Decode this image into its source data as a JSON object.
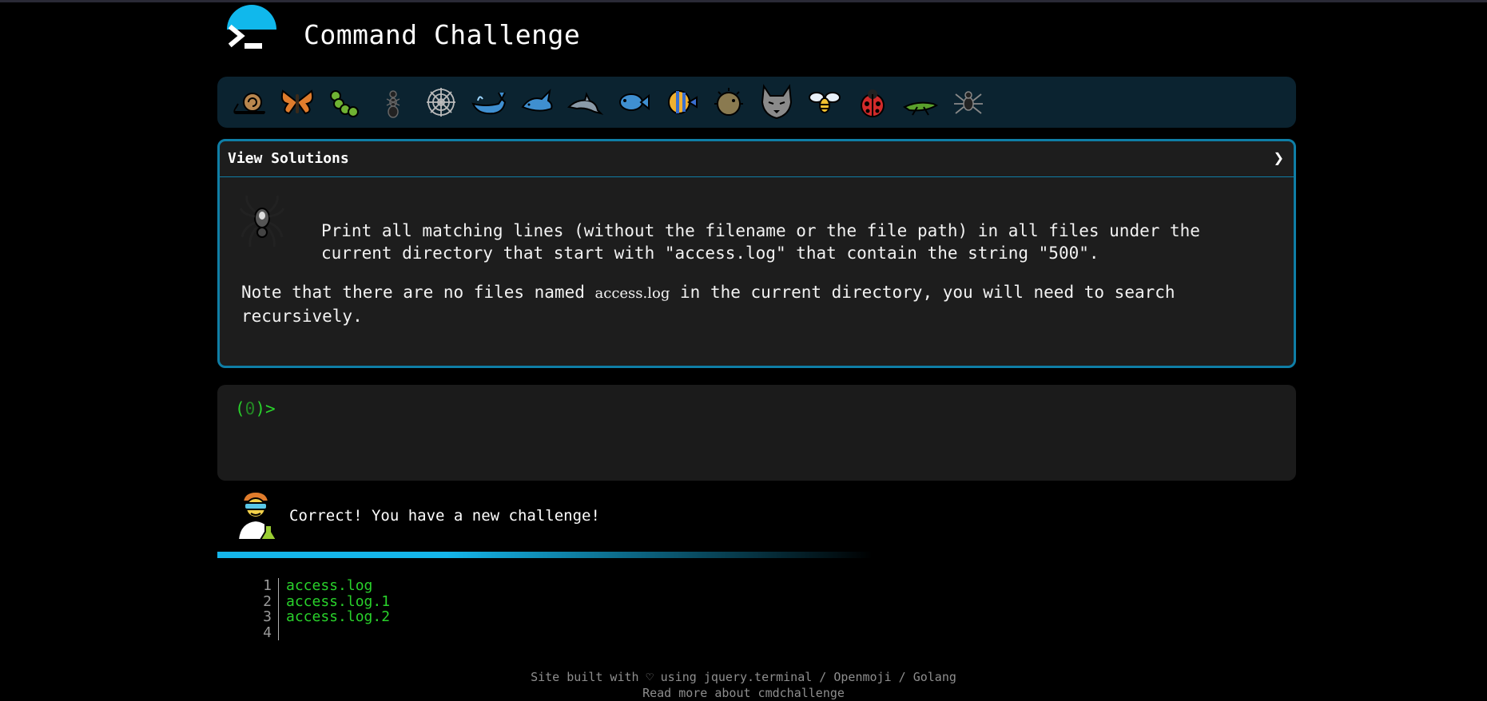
{
  "header": {
    "title": "Command Challenge"
  },
  "emoji_bar": {
    "items": [
      {
        "name": "snail-icon"
      },
      {
        "name": "butterfly-icon"
      },
      {
        "name": "caterpillar-icon"
      },
      {
        "name": "ant-icon"
      },
      {
        "name": "spider-web-icon"
      },
      {
        "name": "whale-icon"
      },
      {
        "name": "shark-icon"
      },
      {
        "name": "dolphin-icon"
      },
      {
        "name": "fish-icon"
      },
      {
        "name": "tropical-fish-icon"
      },
      {
        "name": "blowfish-icon"
      },
      {
        "name": "wolf-icon"
      },
      {
        "name": "bee-icon"
      },
      {
        "name": "ladybug-icon"
      },
      {
        "name": "cricket-icon"
      },
      {
        "name": "spider-icon"
      }
    ]
  },
  "panel": {
    "head_label": "View Solutions",
    "chevron": "❯",
    "description": "Print all matching lines (without the filename or the file path) in all files under the current directory that start with \"access.log\" that contain the string \"500\".",
    "note_before": "Note that there are no files named ",
    "note_code": "access.log",
    "note_after": " in the current directory, you will need to search recursively."
  },
  "terminal": {
    "prompt_open": "(",
    "prompt_count": "0",
    "prompt_close": ")>"
  },
  "status": {
    "message": "Correct! You have a new challenge!"
  },
  "listing": {
    "lines": [
      {
        "n": "1",
        "text": "access.log"
      },
      {
        "n": "2",
        "text": "access.log.1"
      },
      {
        "n": "3",
        "text": "access.log.2"
      },
      {
        "n": "4",
        "text": ""
      }
    ]
  },
  "footer": {
    "line1": "Site built with ♡ using jquery.terminal / Openmoji / Golang",
    "line2": "Read more about cmdchallenge"
  },
  "colors": {
    "accent": "#15b6ea",
    "prompt": "#29d12b",
    "panel_border": "#0f7ea6"
  }
}
